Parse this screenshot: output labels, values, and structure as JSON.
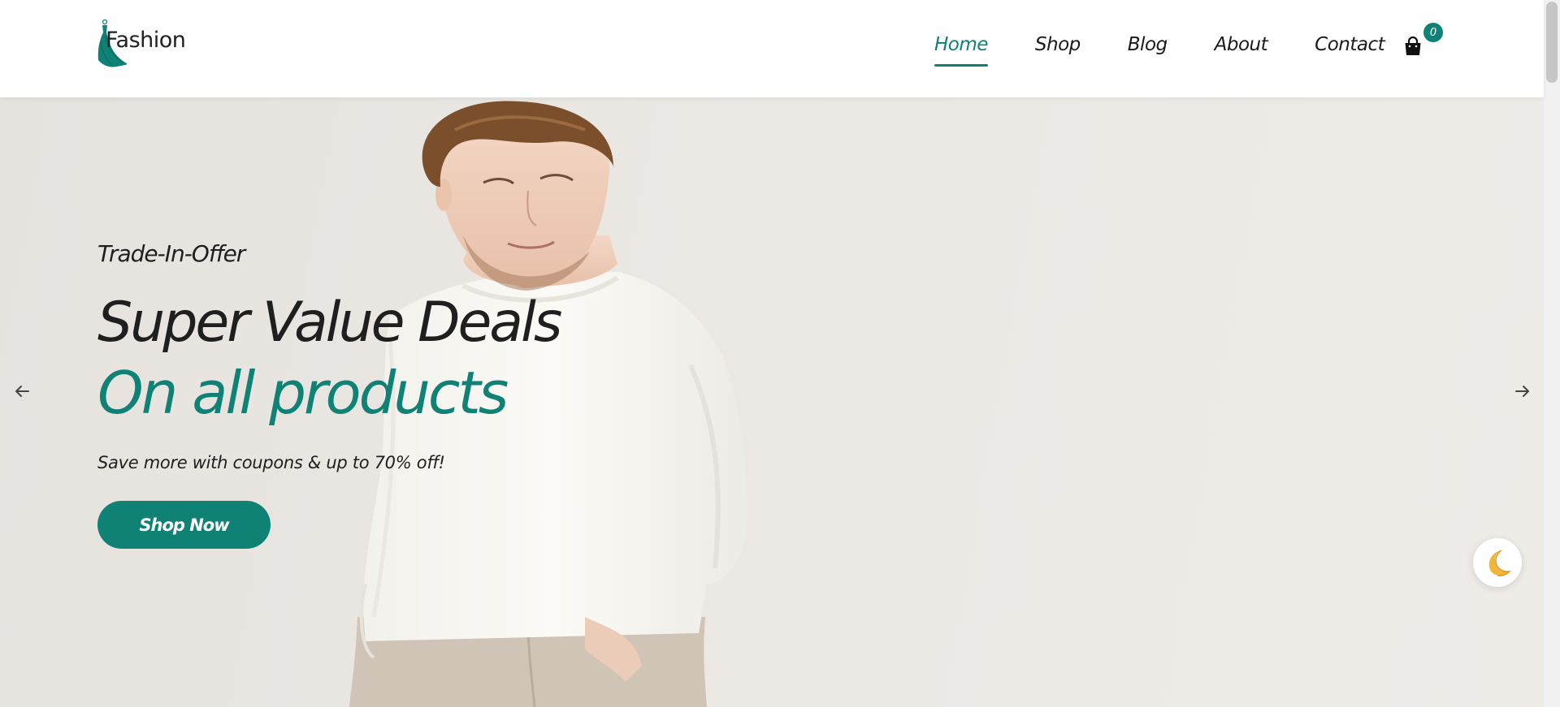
{
  "brand": {
    "name": "Fashion",
    "logo_icon": "dress-icon",
    "accent_color": "#0f8275"
  },
  "nav": {
    "items": [
      {
        "label": "Home",
        "active": true
      },
      {
        "label": "Shop",
        "active": false
      },
      {
        "label": "Blog",
        "active": false
      },
      {
        "label": "About",
        "active": false
      },
      {
        "label": "Contact",
        "active": false
      }
    ],
    "cart": {
      "icon": "shopping-bag-icon",
      "count": "0"
    }
  },
  "hero": {
    "eyebrow": "Trade-In-Offer",
    "headline_1": "Super Value Deals",
    "headline_2": "On all products",
    "subtext": "Save more with coupons & up to 70% off!",
    "cta_label": "Shop Now",
    "prev_icon": "arrow-left-icon",
    "next_icon": "arrow-right-icon"
  },
  "theme_toggle": {
    "icon": "moon-icon"
  }
}
